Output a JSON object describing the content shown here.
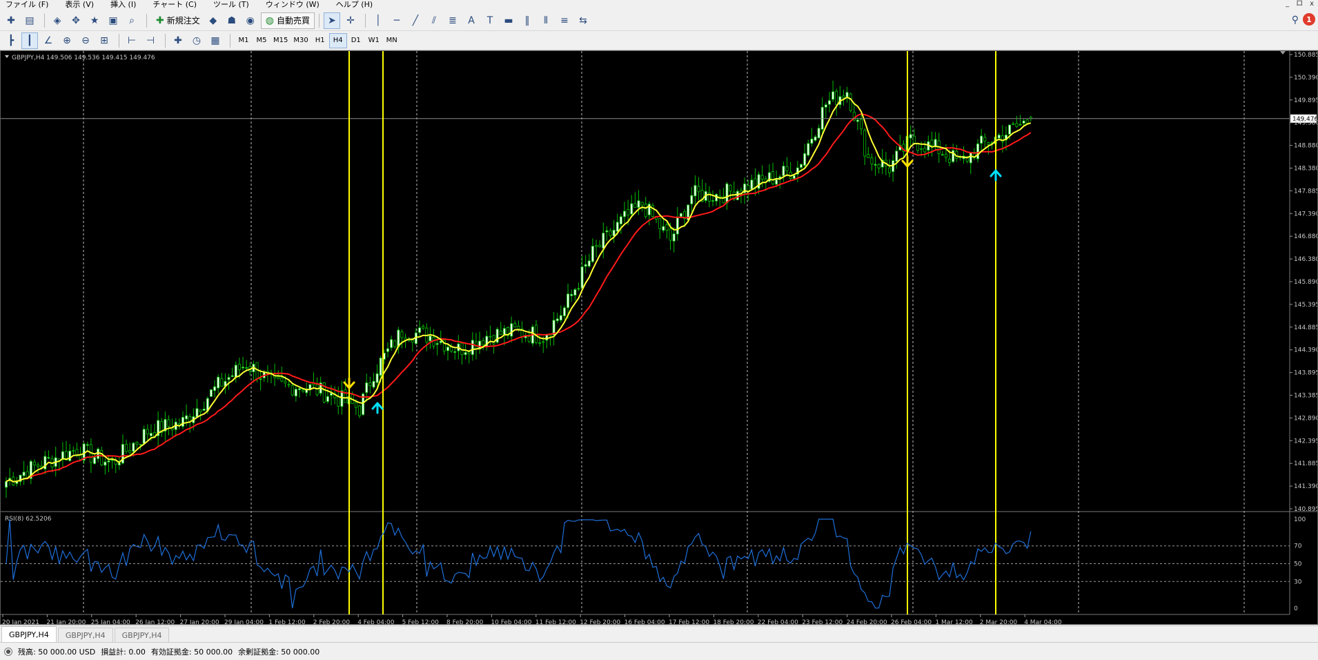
{
  "menu": [
    "ファイル (F)",
    "表示 (V)",
    "挿入 (I)",
    "チャート (C)",
    "ツール (T)",
    "ウィンドウ (W)",
    "ヘルプ (H)"
  ],
  "window_controls": [
    "_",
    "ロ",
    "x"
  ],
  "toolbar": {
    "new_order_label": "新規注文",
    "auto_trade_label": "自動売買",
    "notification_count": "1"
  },
  "timeframes": [
    "M1",
    "M5",
    "M15",
    "M30",
    "H1",
    "H4",
    "D1",
    "W1",
    "MN"
  ],
  "active_timeframe": "H4",
  "chart": {
    "info_text": "GBPJPY,H4  149.506 149.536 149.415 149.476",
    "current_price_label": "149.476",
    "rsi_label": "RSI(8) 62.5206",
    "price_ticks": [
      "150.885",
      "150.390",
      "149.895",
      "149.380",
      "148.880",
      "148.380",
      "147.885",
      "147.390",
      "146.880",
      "146.380",
      "145.890",
      "145.395",
      "144.885",
      "144.390",
      "143.895",
      "143.385",
      "142.890",
      "142.395",
      "141.885",
      "141.390",
      "140.895"
    ],
    "rsi_ticks": [
      "100",
      "70",
      "50",
      "30",
      "0"
    ],
    "time_labels": [
      "20 Jan 2021",
      "21 Jan 20:00",
      "25 Jan 04:00",
      "26 Jan 12:00",
      "27 Jan 20:00",
      "29 Jan 04:00",
      "1 Feb 12:00",
      "2 Feb 20:00",
      "4 Feb 04:00",
      "5 Feb 12:00",
      "8 Feb 20:00",
      "10 Feb 04:00",
      "11 Feb 12:00",
      "12 Feb 20:00",
      "16 Feb 04:00",
      "17 Feb 12:00",
      "18 Feb 20:00",
      "22 Feb 04:00",
      "23 Feb 12:00",
      "24 Feb 20:00",
      "26 Feb 04:00",
      "1 Mar 12:00",
      "2 Mar 20:00",
      "4 Mar 04:00"
    ],
    "colors": {
      "background": "#000000",
      "bull_candle": "#00c000",
      "bull_body": "#e8ffe8",
      "bear_candle": "#00c000",
      "ma_fast": "#ffff33",
      "ma_slow": "#ff1a1a",
      "rsi_line": "#1e6fd9",
      "marker_line": "#ffff00",
      "sell_arrow": "#ffe100",
      "buy_arrow": "#00e0ff"
    }
  },
  "chart_data": {
    "type": "candlestick",
    "symbol": "GBPJPY",
    "timeframe": "H4",
    "ylim": [
      140.895,
      150.885
    ],
    "rsi_ylim": [
      0,
      100
    ],
    "rsi_period": 8,
    "rsi_levels": [
      30,
      50,
      70
    ],
    "close_anchors": [
      [
        0,
        141.5
      ],
      [
        10,
        141.9
      ],
      [
        20,
        142.2
      ],
      [
        30,
        141.9
      ],
      [
        40,
        142.6
      ],
      [
        50,
        142.8
      ],
      [
        60,
        143.6
      ],
      [
        68,
        144.1
      ],
      [
        76,
        143.6
      ],
      [
        84,
        143.6
      ],
      [
        92,
        143.4
      ],
      [
        100,
        143.1
      ],
      [
        104,
        143.9
      ],
      [
        112,
        144.8
      ],
      [
        120,
        144.7
      ],
      [
        128,
        144.4
      ],
      [
        136,
        144.7
      ],
      [
        144,
        144.8
      ],
      [
        152,
        144.7
      ],
      [
        158,
        145.3
      ],
      [
        166,
        146.5
      ],
      [
        174,
        147.2
      ],
      [
        180,
        147.6
      ],
      [
        188,
        146.8
      ],
      [
        194,
        147.8
      ],
      [
        202,
        147.8
      ],
      [
        210,
        148.0
      ],
      [
        218,
        148.2
      ],
      [
        224,
        148.4
      ],
      [
        232,
        149.8
      ],
      [
        238,
        150.1
      ],
      [
        244,
        148.6
      ],
      [
        250,
        148.4
      ],
      [
        256,
        149.0
      ],
      [
        264,
        148.8
      ],
      [
        270,
        148.5
      ],
      [
        276,
        148.9
      ],
      [
        284,
        149.2
      ],
      [
        290,
        149.47
      ]
    ],
    "sell_signals": [
      "3 Feb 20:00",
      "26 Feb 04:00"
    ],
    "buy_signals": [
      "4 Feb 12:00",
      "3 Mar 04:00"
    ]
  },
  "tabs": [
    "GBPJPY,H4",
    "GBPJPY,H4",
    "GBPJPY,H4"
  ],
  "status": {
    "balance": "残高: 50 000.00 USD",
    "profit": "損益計: 0.00",
    "equity": "有効証拠金: 50 000.00",
    "free_margin": "余剰証拠金: 50 000.00"
  }
}
